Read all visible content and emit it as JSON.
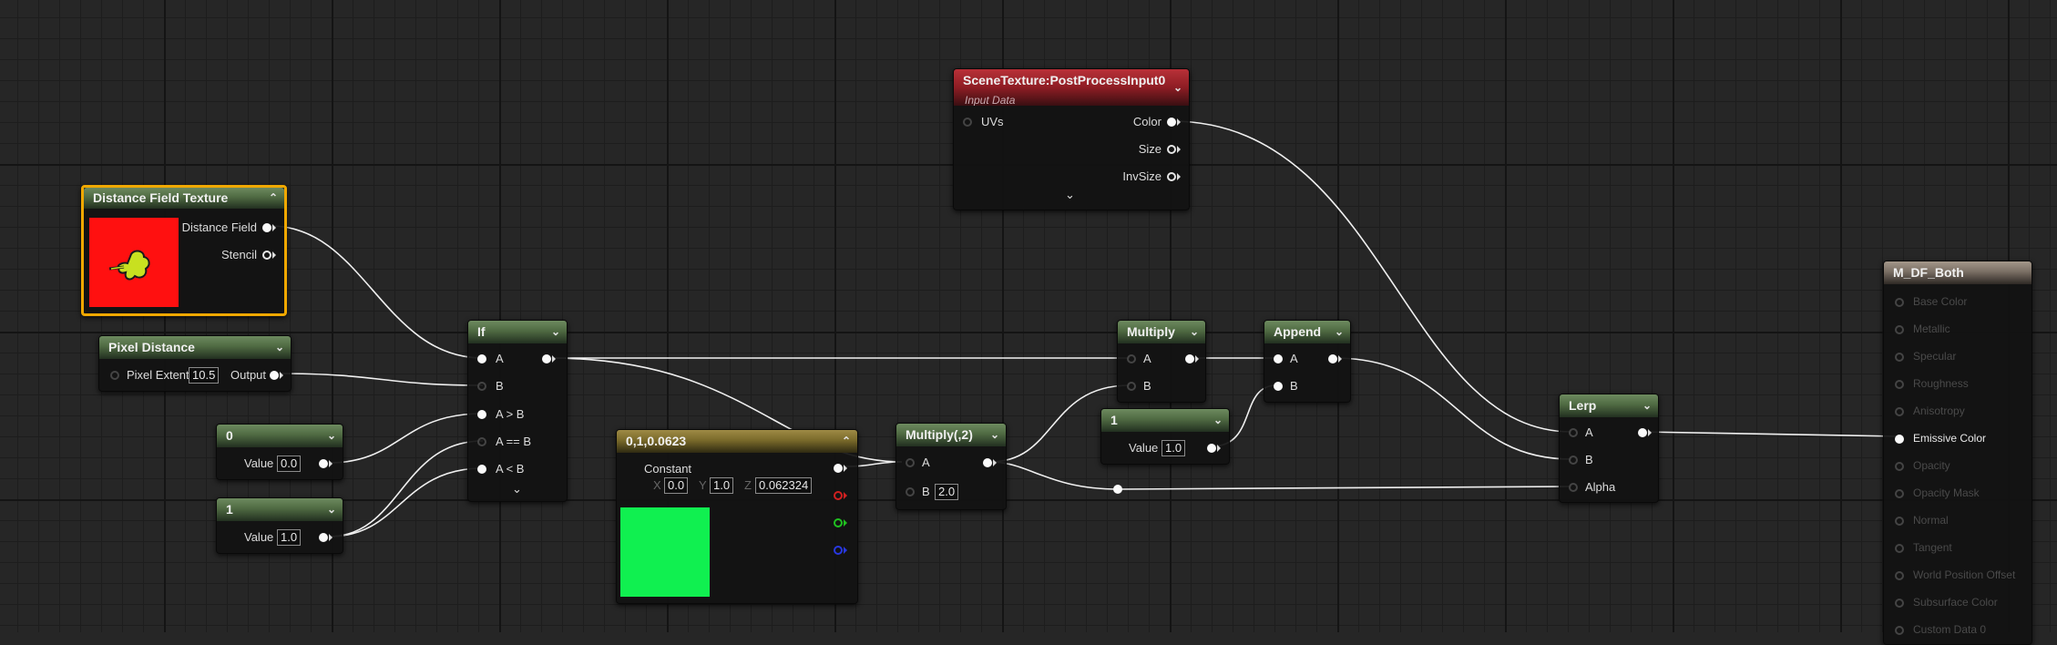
{
  "nodes": {
    "distance_field": {
      "title": "Distance Field Texture",
      "outputs": [
        "Distance Field",
        "Stencil"
      ]
    },
    "pixel_distance": {
      "title": "Pixel Distance",
      "input_label": "Pixel Extent",
      "value": "10.5",
      "output_label": "Output"
    },
    "const_zero": {
      "title": "0",
      "label": "Value",
      "value": "0.0"
    },
    "const_one": {
      "title": "1",
      "label": "Value",
      "value": "1.0"
    },
    "if_node": {
      "title": "If",
      "inputs": [
        "A",
        "B",
        "A > B",
        "A == B",
        "A < B"
      ]
    },
    "vector_const": {
      "title": "0,1,0.0623",
      "label": "Constant",
      "x": "0.0",
      "y": "1.0",
      "z": "0.062324",
      "x_label": "X",
      "y_label": "Y",
      "z_label": "Z"
    },
    "multiply2": {
      "title": "Multiply(,2)",
      "a_label": "A",
      "b_label": "B",
      "b_value": "2.0"
    },
    "multiply": {
      "title": "Multiply",
      "inputs": [
        "A",
        "B"
      ]
    },
    "const_one_b": {
      "title": "1",
      "label": "Value",
      "value": "1.0"
    },
    "append": {
      "title": "Append",
      "inputs": [
        "A",
        "B"
      ]
    },
    "scene_texture": {
      "title": "SceneTexture:PostProcessInput0",
      "subtitle": "Input Data",
      "input": "UVs",
      "outputs": [
        "Color",
        "Size",
        "InvSize"
      ]
    },
    "lerp": {
      "title": "Lerp",
      "inputs": [
        "A",
        "B",
        "Alpha"
      ]
    },
    "material": {
      "title": "M_DF_Both",
      "inputs": [
        "Base Color",
        "Metallic",
        "Specular",
        "Roughness",
        "Anisotropy",
        "Emissive Color",
        "Opacity",
        "Opacity Mask",
        "Normal",
        "Tangent",
        "World Position Offset",
        "Subsurface Color",
        "Custom Data 0"
      ],
      "active": "Emissive Color"
    }
  },
  "colors": {
    "texture_preview_bg": "#ff1010",
    "texture_blob": "#c8e020",
    "vector_preview": "#10f050",
    "selection": "#f0a800",
    "wire": "#f2f2f2"
  },
  "icons": [
    "collapse-chevron-icon",
    "expand-chevron-icon",
    "pin-icon"
  ]
}
